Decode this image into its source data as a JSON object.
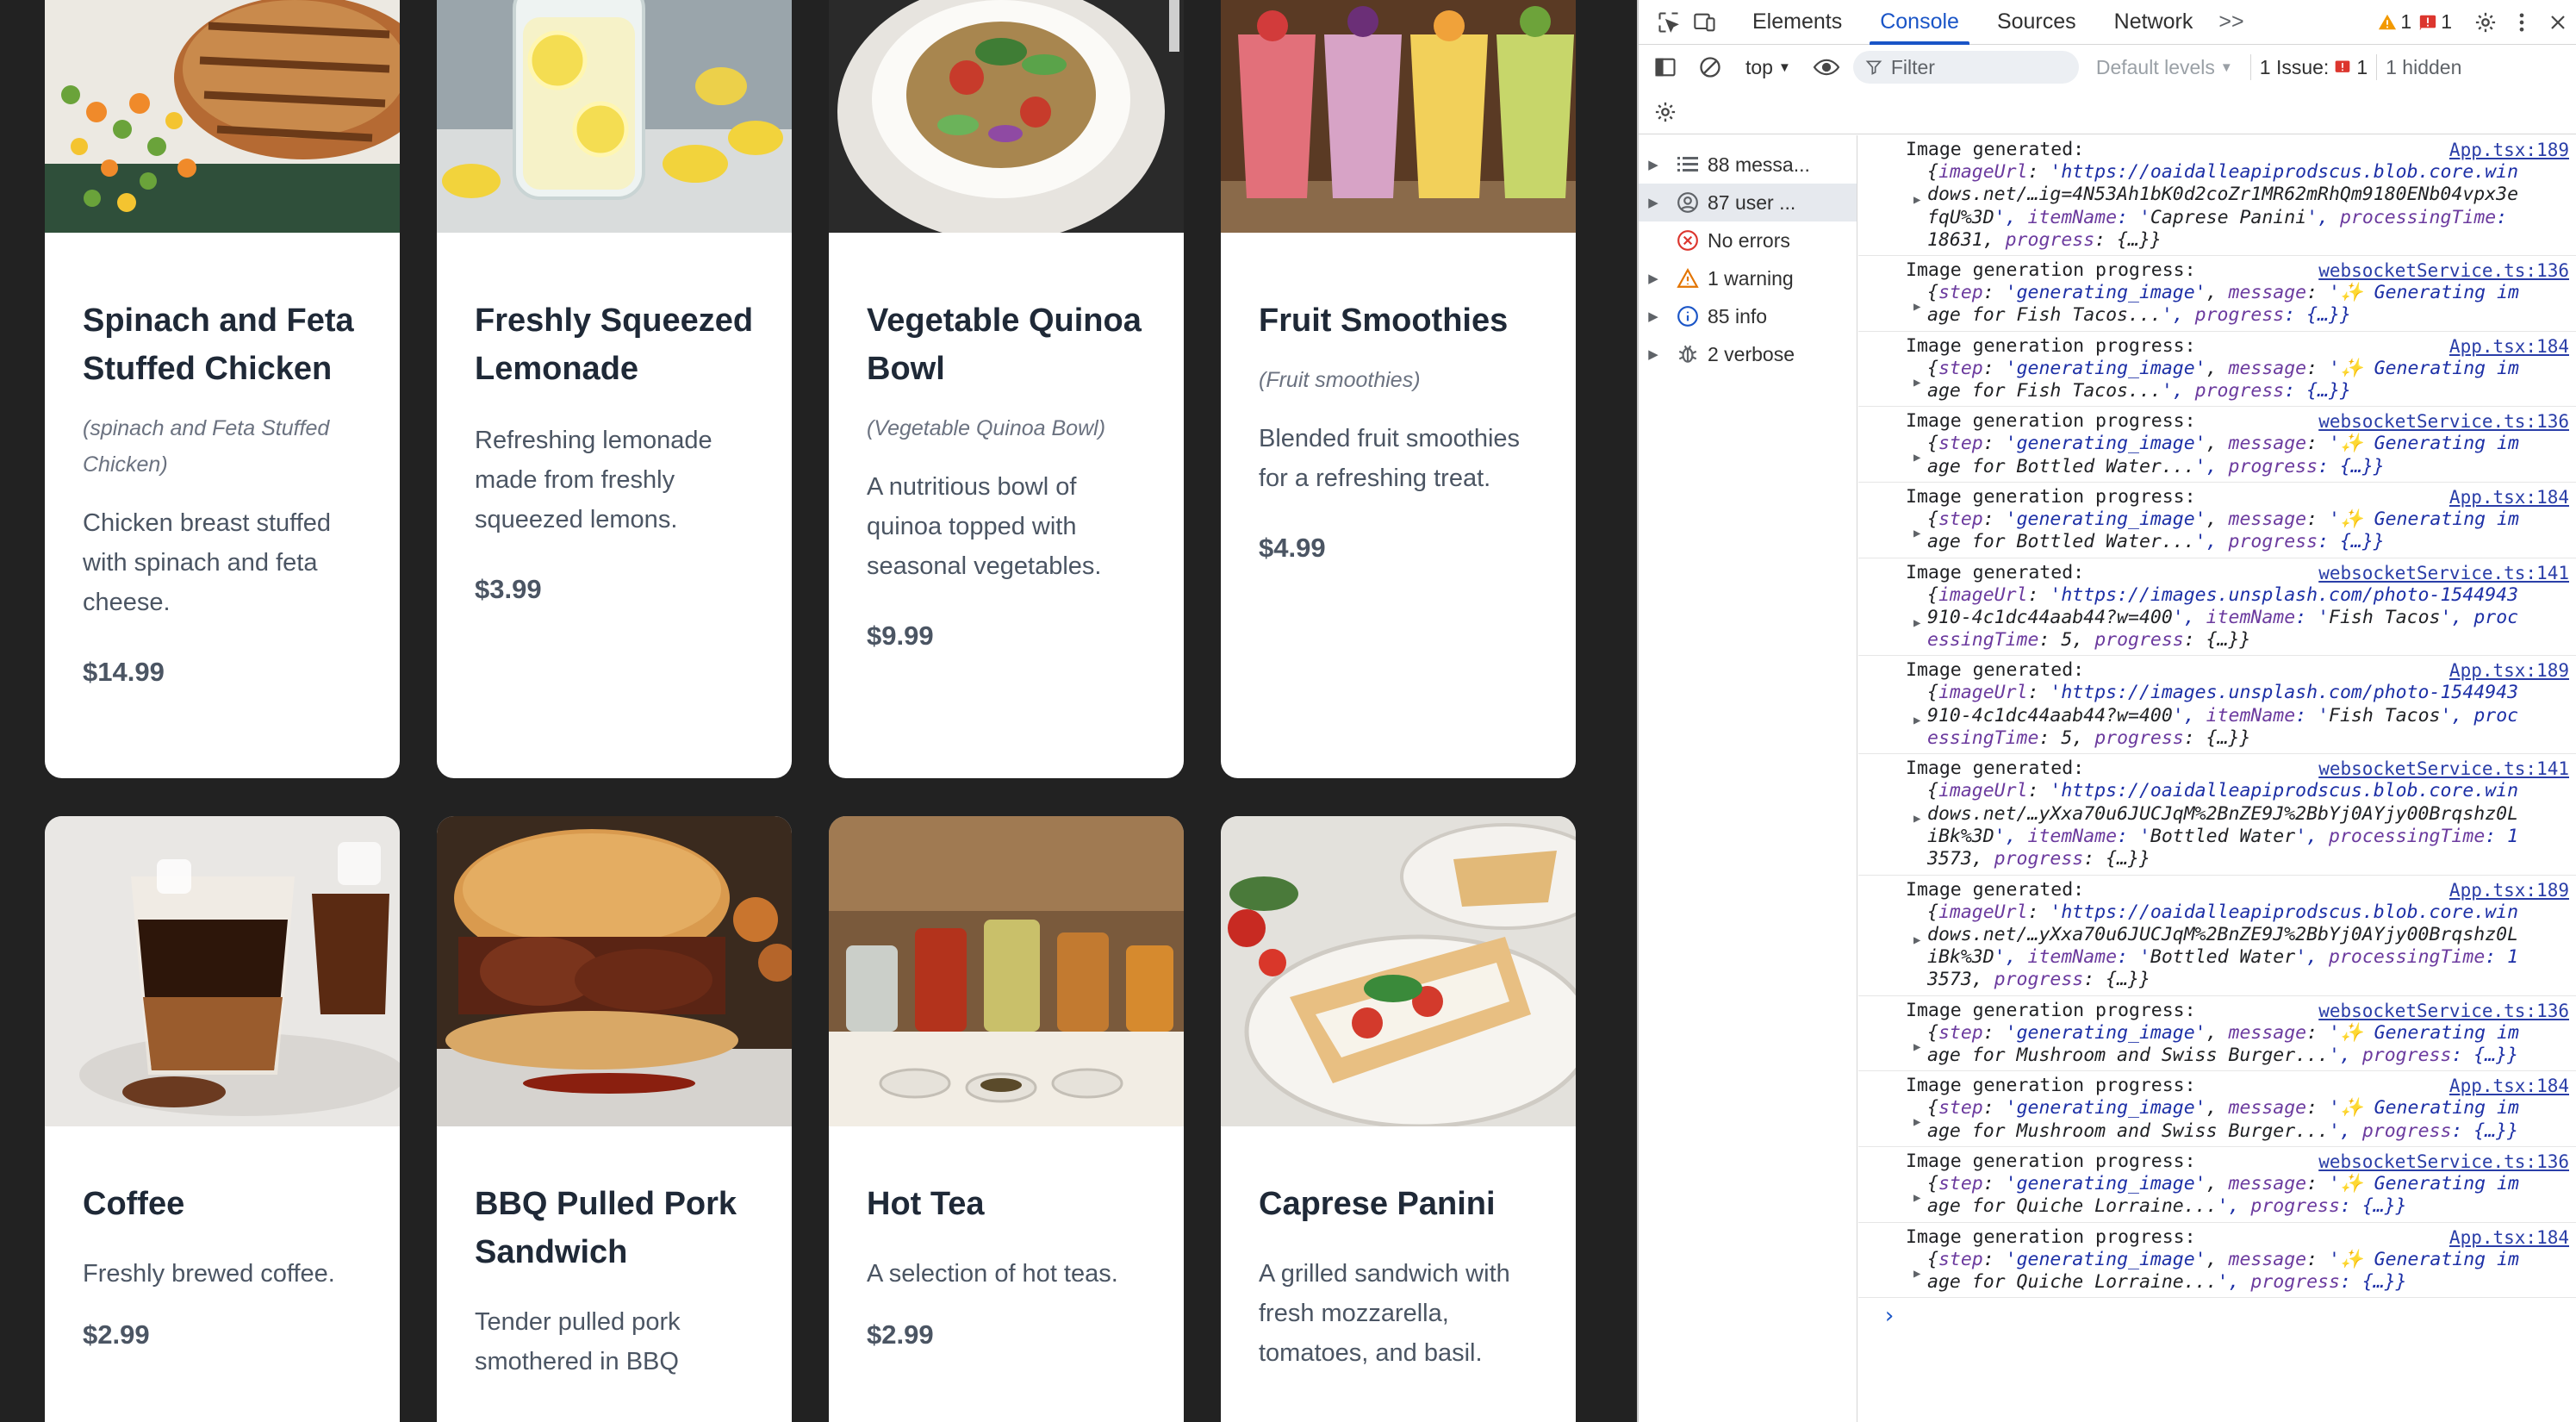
{
  "menu": {
    "cards": [
      {
        "title": "Spinach and Feta Stuffed Chicken",
        "alt": "(spinach and Feta Stuffed Chicken)",
        "desc": "Chicken breast stuffed with spinach and feta cheese.",
        "price": "$14.99"
      },
      {
        "title": "Freshly Squeezed Lemonade",
        "alt": "",
        "desc": "Refreshing lemonade made from freshly squeezed lemons.",
        "price": "$3.99"
      },
      {
        "title": "Vegetable Quinoa Bowl",
        "alt": "(Vegetable Quinoa Bowl)",
        "desc": "A nutritious bowl of quinoa topped with seasonal vegetables.",
        "price": "$9.99"
      },
      {
        "title": "Fruit Smoothies",
        "alt": "(Fruit smoothies)",
        "desc": "Blended fruit smoothies for a refreshing treat.",
        "price": "$4.99"
      },
      {
        "title": "Coffee",
        "alt": "",
        "desc": "Freshly brewed coffee.",
        "price": "$2.99"
      },
      {
        "title": "BBQ Pulled Pork Sandwich",
        "alt": "",
        "desc": "Tender pulled pork smothered in BBQ",
        "price": ""
      },
      {
        "title": "Hot Tea",
        "alt": "",
        "desc": "A selection of hot teas.",
        "price": "$2.99"
      },
      {
        "title": "Caprese Panini",
        "alt": "",
        "desc": "A grilled sandwich with fresh mozzarella, tomatoes, and basil.",
        "price": ""
      }
    ]
  },
  "devtools": {
    "tabs": [
      "Elements",
      "Console",
      "Sources",
      "Network"
    ],
    "active_tab": "Console",
    "more_tabs": ">>",
    "warnings_count": "1",
    "errors_count": "1",
    "context": "top",
    "filter_placeholder": "Filter",
    "levels": "Default levels",
    "issues_label": "1 Issue:",
    "issues_count": "1",
    "hidden_label": "1 hidden",
    "sidebar": [
      {
        "label": "88 messa...",
        "icon": "list-icon"
      },
      {
        "label": "87 user ...",
        "icon": "user-icon"
      },
      {
        "label": "No errors",
        "icon": "error-icon"
      },
      {
        "label": "1 warning",
        "icon": "warning-icon"
      },
      {
        "label": "85 info",
        "icon": "info-icon"
      },
      {
        "label": "2 verbose",
        "icon": "bug-icon"
      }
    ],
    "logs": [
      {
        "head": "Image generated:",
        "src": "App.tsx:189",
        "lines": [
          "{imageUrl: 'https://oaidalleapiprodscus.blob.core.win",
          "dows.net/…ig=4N53Ah1bK0d2coZr1MR62mRhQm9180ENb04vpx3e",
          "fqU%3D', itemName: 'Caprese Panini', processingTime:",
          "18631, progress: {…}}"
        ]
      },
      {
        "head": "Image generation progress:",
        "src": "websocketService.ts:136",
        "lines": [
          "{step: 'generating_image', message: '✨ Generating im",
          "age for Fish Tacos...', progress: {…}}"
        ]
      },
      {
        "head": "Image generation progress:",
        "src": "App.tsx:184",
        "lines": [
          "{step: 'generating_image', message: '✨ Generating im",
          "age for Fish Tacos...', progress: {…}}"
        ]
      },
      {
        "head": "Image generation progress:",
        "src": "websocketService.ts:136",
        "lines": [
          "{step: 'generating_image', message: '✨ Generating im",
          "age for Bottled Water...', progress: {…}}"
        ]
      },
      {
        "head": "Image generation progress:",
        "src": "App.tsx:184",
        "lines": [
          "{step: 'generating_image', message: '✨ Generating im",
          "age for Bottled Water...', progress: {…}}"
        ]
      },
      {
        "head": "Image generated:",
        "src": "websocketService.ts:141",
        "lines": [
          "{imageUrl: 'https://images.unsplash.com/photo-1544943",
          "910-4c1dc44aab44?w=400', itemName: 'Fish Tacos', proc",
          "essingTime: 5, progress: {…}}"
        ]
      },
      {
        "head": "Image generated:",
        "src": "App.tsx:189",
        "lines": [
          "{imageUrl: 'https://images.unsplash.com/photo-1544943",
          "910-4c1dc44aab44?w=400', itemName: 'Fish Tacos', proc",
          "essingTime: 5, progress: {…}}"
        ]
      },
      {
        "head": "Image generated:",
        "src": "websocketService.ts:141",
        "lines": [
          "{imageUrl: 'https://oaidalleapiprodscus.blob.core.win",
          "dows.net/…yXxa70u6JUCJqM%2BnZE9J%2BbYj0AYjy00Brqshz0L",
          "iBk%3D', itemName: 'Bottled Water', processingTime: 1",
          "3573, progress: {…}}"
        ]
      },
      {
        "head": "Image generated:",
        "src": "App.tsx:189",
        "lines": [
          "{imageUrl: 'https://oaidalleapiprodscus.blob.core.win",
          "dows.net/…yXxa70u6JUCJqM%2BnZE9J%2BbYj0AYjy00Brqshz0L",
          "iBk%3D', itemName: 'Bottled Water', processingTime: 1",
          "3573, progress: {…}}"
        ]
      },
      {
        "head": "Image generation progress:",
        "src": "websocketService.ts:136",
        "lines": [
          "{step: 'generating_image', message: '✨ Generating im",
          "age for Mushroom and Swiss Burger...', progress: {…}}"
        ]
      },
      {
        "head": "Image generation progress:",
        "src": "App.tsx:184",
        "lines": [
          "{step: 'generating_image', message: '✨ Generating im",
          "age for Mushroom and Swiss Burger...', progress: {…}}"
        ]
      },
      {
        "head": "Image generation progress:",
        "src": "websocketService.ts:136",
        "lines": [
          "{step: 'generating_image', message: '✨ Generating im",
          "age for Quiche Lorraine...', progress: {…}}"
        ]
      },
      {
        "head": "Image generation progress:",
        "src": "App.tsx:184",
        "lines": [
          "{step: 'generating_image', message: '✨ Generating im",
          "age for Quiche Lorraine...', progress: {…}}"
        ]
      }
    ],
    "prompt_symbol": "›"
  }
}
